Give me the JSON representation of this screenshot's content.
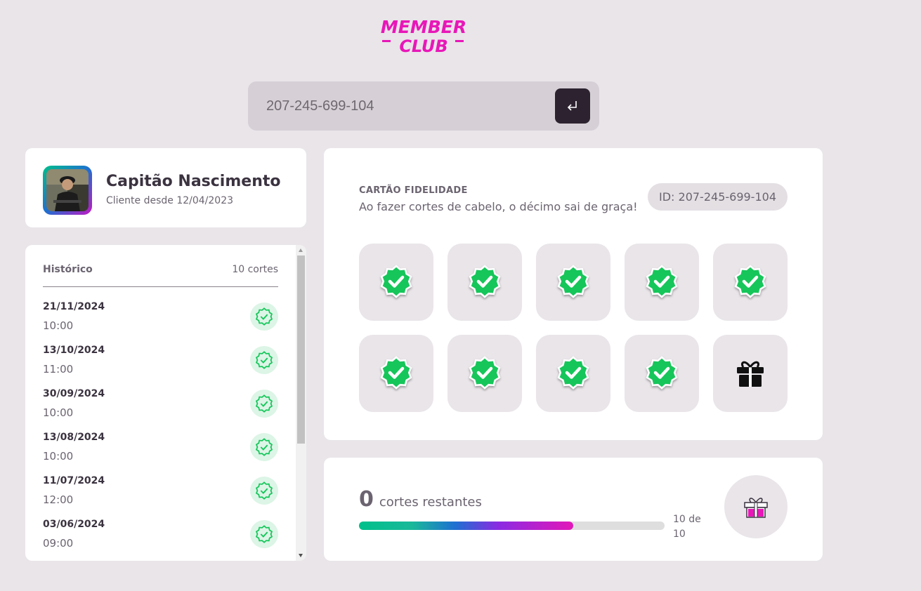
{
  "brand": {
    "line1": "MEMBER",
    "line2": "CLUB",
    "color": "#e817b8"
  },
  "search": {
    "value": "207-245-699-104",
    "icon": "enter-icon"
  },
  "profile": {
    "name": "Capitão Nascimento",
    "since": "Cliente desde 12/04/2023"
  },
  "history": {
    "title": "Histórico",
    "count": "10 cortes",
    "items": [
      {
        "date": "21/11/2024",
        "time": "10:00"
      },
      {
        "date": "13/10/2024",
        "time": "11:00"
      },
      {
        "date": "30/09/2024",
        "time": "10:00"
      },
      {
        "date": "13/08/2024",
        "time": "10:00"
      },
      {
        "date": "11/07/2024",
        "time": "12:00"
      },
      {
        "date": "03/06/2024",
        "time": "09:00"
      }
    ]
  },
  "loyalty": {
    "label": "CARTÃO FIDELIDADE",
    "description": "Ao fazer cortes de cabelo, o décimo sai de graça!",
    "id": "ID: 207-245-699-104",
    "slots": [
      "check",
      "check",
      "check",
      "check",
      "check",
      "check",
      "check",
      "check",
      "check",
      "gift"
    ]
  },
  "remaining": {
    "count": "0",
    "label": "cortes restantes",
    "of": "10 de 10",
    "progress": 0.7
  },
  "colors": {
    "accent": "#e817b8",
    "check_green": "#15c65a",
    "dark": "#2d2330"
  }
}
